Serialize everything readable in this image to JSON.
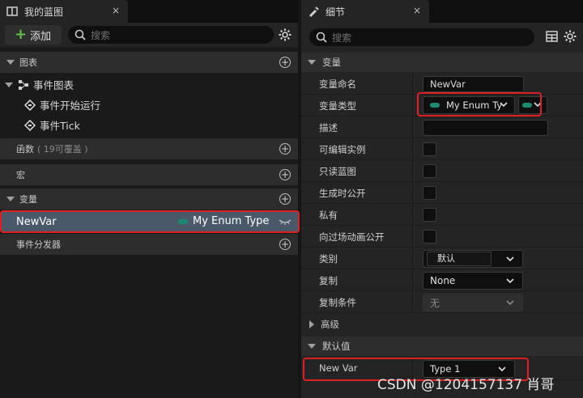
{
  "left": {
    "tab_title": "我的蓝图",
    "tab_close": "×",
    "add_label": "添加",
    "search_placeholder": "搜索",
    "sections": {
      "graphs": "图表",
      "functions": "函数",
      "functions_note": "( 19可覆盖 )",
      "macros": "宏",
      "variables": "变量",
      "dispatchers": "事件分发器"
    },
    "tree": {
      "event_graph": "事件图表",
      "begin_play": "事件开始运行",
      "tick": "事件Tick"
    },
    "selected_var": {
      "name": "NewVar",
      "type": "My Enum Type"
    }
  },
  "right": {
    "tab_title": "细节",
    "tab_close": "×",
    "search_placeholder": "搜索",
    "section_variable": "变量",
    "section_advanced": "高级",
    "section_default": "默认值",
    "rows": {
      "var_name_label": "变量命名",
      "var_name_value": "NewVar",
      "var_type_label": "变量类型",
      "var_type_value": "My Enum Ty",
      "desc_label": "描述",
      "editable_label": "可编辑实例",
      "readonly_label": "只读蓝图",
      "expose_spawn_label": "生成时公开",
      "private_label": "私有",
      "expose_cine_label": "向过场动画公开",
      "category_label": "类别",
      "category_value": "默认",
      "replication_label": "复制",
      "replication_value": "None",
      "rep_cond_label": "复制条件",
      "rep_cond_value": "无",
      "newvar_label": "New Var",
      "newvar_value": "Type 1"
    }
  },
  "watermark": "CSDN @1204157137 肖哥",
  "colors": {
    "enum_pill": "#1a8a72",
    "highlight_red": "#e02020",
    "selected_row": "#4a5969",
    "add_plus": "#5ec14a"
  },
  "icons": [
    "blueprint-tab-icon",
    "plus-icon",
    "search-icon",
    "gear-icon",
    "add-circle-icon",
    "graph-icon",
    "event-diamond-icon",
    "eye-icon",
    "details-tab-icon",
    "table-view-icon",
    "chevron-down-icon"
  ]
}
